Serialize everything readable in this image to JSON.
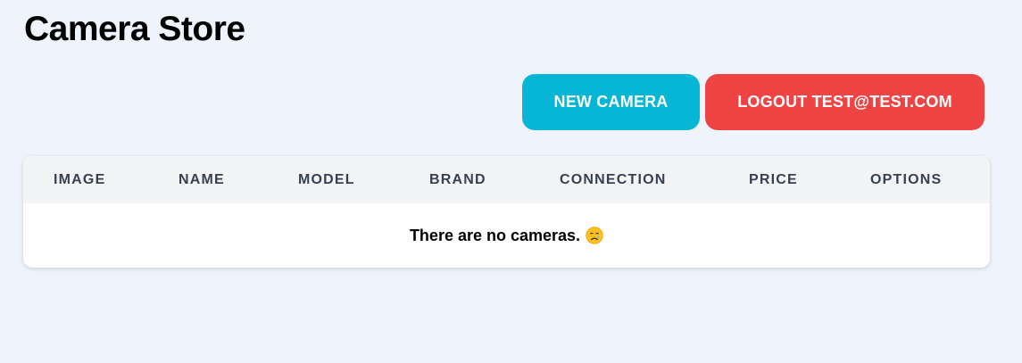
{
  "header": {
    "title": "Camera Store"
  },
  "toolbar": {
    "new_camera_label": "NEW CAMERA",
    "logout_label": "LOGOUT TEST@TEST.COM"
  },
  "table": {
    "columns": [
      "IMAGE",
      "NAME",
      "MODEL",
      "BRAND",
      "CONNECTION",
      "PRICE",
      "OPTIONS"
    ],
    "empty_message": "There are no cameras.",
    "empty_icon": "crying-face-icon"
  },
  "colors": {
    "background": "#eff3fb",
    "new_button": "#06b6d4",
    "logout_button": "#ef4444",
    "table_header": "#f3f4f6"
  }
}
